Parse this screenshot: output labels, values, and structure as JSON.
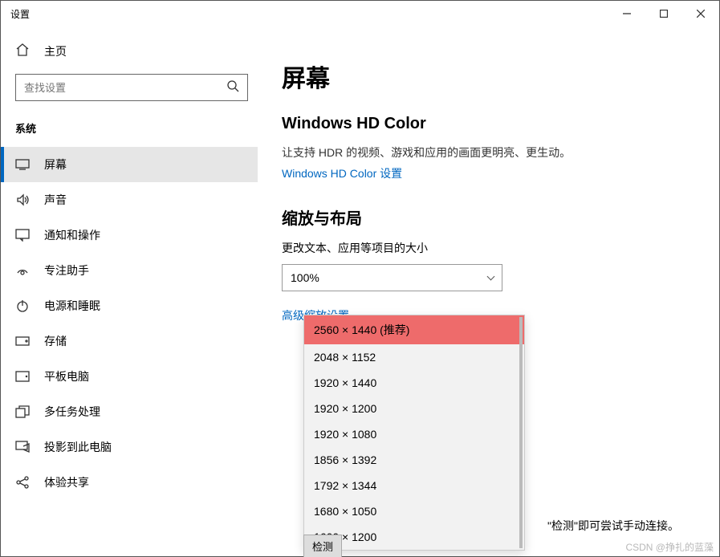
{
  "window": {
    "title": "设置"
  },
  "sidebar": {
    "home": "主页",
    "search_placeholder": "查找设置",
    "section": "系统",
    "items": [
      {
        "label": "屏幕"
      },
      {
        "label": "声音"
      },
      {
        "label": "通知和操作"
      },
      {
        "label": "专注助手"
      },
      {
        "label": "电源和睡眠"
      },
      {
        "label": "存储"
      },
      {
        "label": "平板电脑"
      },
      {
        "label": "多任务处理"
      },
      {
        "label": "投影到此电脑"
      },
      {
        "label": "体验共享"
      }
    ]
  },
  "content": {
    "page_title": "屏幕",
    "hdcolor_heading": "Windows HD Color",
    "hdcolor_desc": "让支持 HDR 的视频、游戏和应用的画面更明亮、更生动。",
    "hdcolor_link": "Windows HD Color 设置",
    "scale_heading": "缩放与布局",
    "scale_label": "更改文本、应用等项目的大小",
    "scale_value": "100%",
    "adv_scale_link": "高级缩放设置",
    "resolutions": [
      "2560 × 1440 (推荐)",
      "2048 × 1152",
      "1920 × 1440",
      "1920 × 1200",
      "1920 × 1080",
      "1856 × 1392",
      "1792 × 1344",
      "1680 × 1050",
      "1600 × 1200"
    ],
    "detect_button": "检测",
    "footer_hint": "\"检测\"即可尝试手动连接。"
  },
  "watermark": "CSDN @挣扎的蓝藻"
}
